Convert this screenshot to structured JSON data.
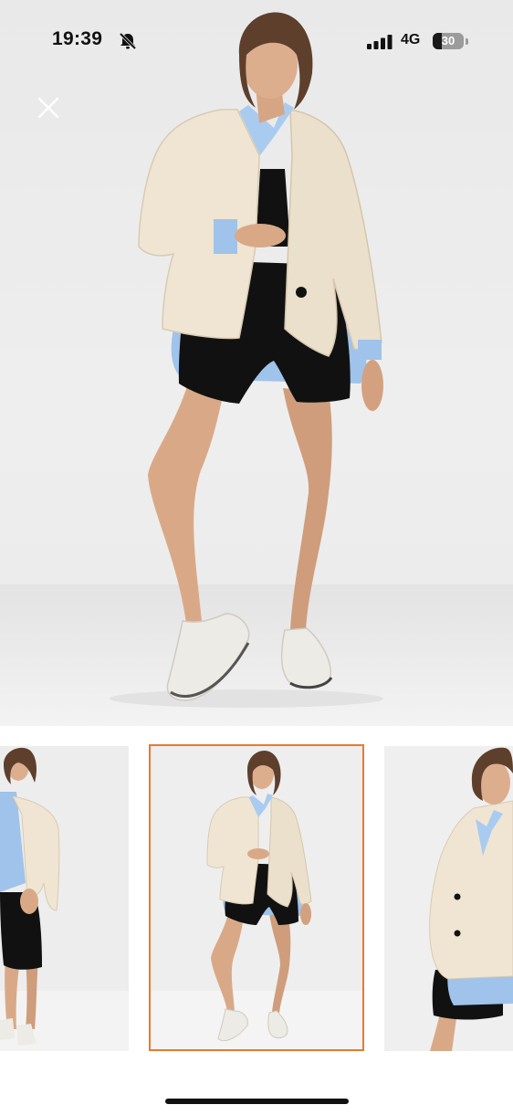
{
  "status_bar": {
    "time": "19:39",
    "network": "4G",
    "battery_level": "30",
    "battery_percent": 30,
    "silent_icon": "bell-slash-icon",
    "signal_icon": "cellular-signal-icon"
  },
  "gallery": {
    "close_icon": "close-icon",
    "selected_index": 1,
    "selected_border_color": "#e97a2c",
    "thumbnails": [
      {
        "id": "thumb-1",
        "selected": false
      },
      {
        "id": "thumb-2",
        "selected": true
      },
      {
        "id": "thumb-3",
        "selected": false
      }
    ]
  }
}
